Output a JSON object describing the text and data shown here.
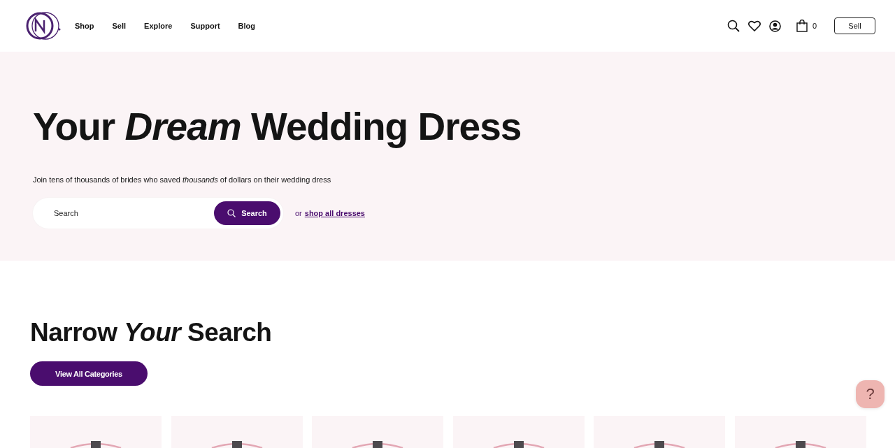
{
  "nav": {
    "links": [
      "Shop",
      "Sell",
      "Explore",
      "Support",
      "Blog"
    ],
    "cart_count": "0",
    "sell_button": "Sell"
  },
  "hero": {
    "title": "Your *Dream* Wedding Dress",
    "subtitle": "Join tens of thousands of brides who saved *thousands* of dollars on their wedding dress",
    "search": {
      "placeholder": "Search",
      "button": "Search"
    },
    "or_text": "or",
    "link": "shop all dresses"
  },
  "categories": {
    "title": "Narrow *Your* Search",
    "button": "View All Categories"
  },
  "help_button": "?"
}
